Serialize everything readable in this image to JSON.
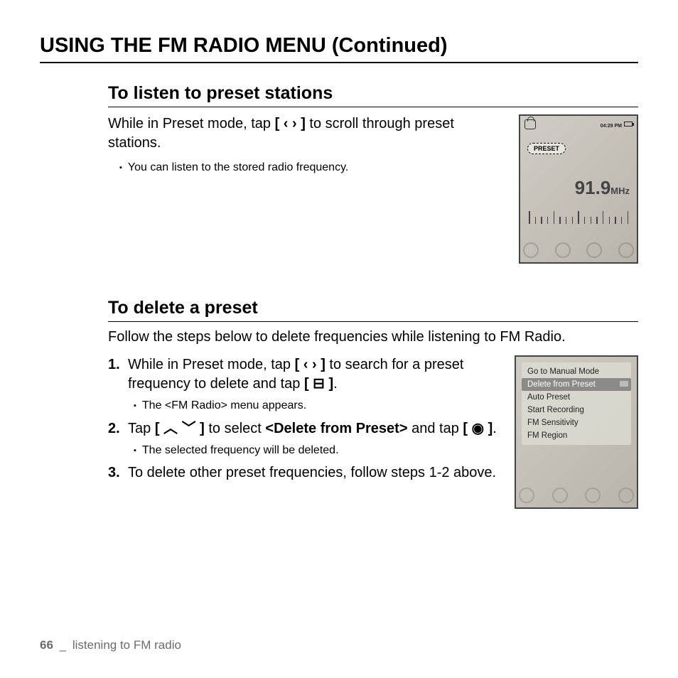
{
  "page_title": "USING THE FM RADIO MENU (Continued)",
  "section1": {
    "heading": "To listen to preset stations",
    "lead_pre": "While in Preset mode, tap ",
    "lead_icon": "[ ‹  › ]",
    "lead_post": " to scroll through preset stations.",
    "bullet1": "You can listen to the stored radio frequency."
  },
  "device1": {
    "time": "04:29 PM",
    "preset_label": "PRESET",
    "frequency": "91.9",
    "unit": "MHz"
  },
  "section2": {
    "heading": "To delete a preset",
    "lead": "Follow the steps below to delete frequencies while listening to FM Radio.",
    "step1_a": "While in Preset mode, tap ",
    "step1_icon1": "[ ‹  › ]",
    "step1_b": " to search for a preset frequency to delete and tap ",
    "step1_icon2": "[ ⊟ ]",
    "step1_c": ".",
    "step1_sub": "The <FM Radio> menu appears.",
    "step2_a": "Tap ",
    "step2_icon1": "[ ︿ ﹀ ]",
    "step2_b": " to select ",
    "step2_bold": "<Delete from Preset>",
    "step2_c": " and tap ",
    "step2_icon2": "[ ◉ ]",
    "step2_d": ".",
    "step2_sub": "The selected frequency will be deleted.",
    "step3": "To delete other preset frequencies, follow steps 1-2 above."
  },
  "device2": {
    "menu": [
      "Go to Manual Mode",
      "Delete from Preset",
      "Auto Preset",
      "Start Recording",
      "FM Sensitivity",
      "FM Region"
    ],
    "selected_index": 1
  },
  "footer": {
    "page_number": "66",
    "separator": "_",
    "chapter": "listening to FM radio"
  }
}
